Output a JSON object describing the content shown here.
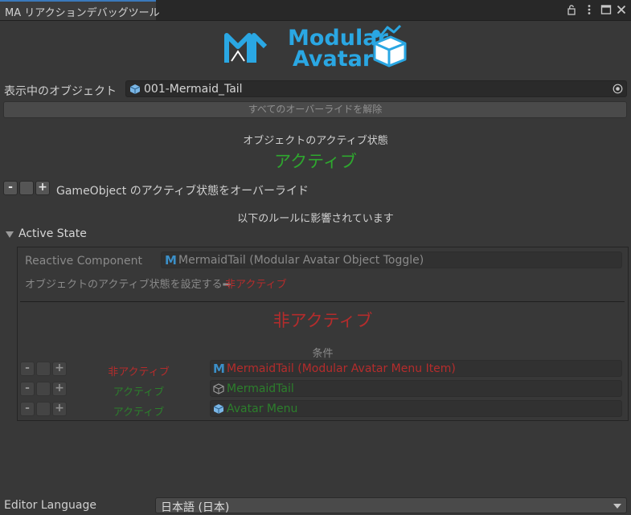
{
  "window": {
    "tab_title": "MA リアクションデバッグツール",
    "icons": [
      "lock-icon",
      "kebab-menu-icon",
      "maximize-icon",
      "close-icon"
    ]
  },
  "logo": {
    "line1": "Modular",
    "line2": "Avatar",
    "color": "#2aa7e3"
  },
  "target": {
    "label": "表示中のオブジェクト",
    "value": "001-Mermaid_Tail"
  },
  "clear_overrides_button": "すべてのオーバーライドを解除",
  "active_state": {
    "heading": "オブジェクトのアクティブ状態",
    "value": "アクティブ",
    "color": "#2ea82e"
  },
  "override": {
    "minus": "-",
    "plus": "+",
    "label": "GameObject のアクティブ状態をオーバーライド"
  },
  "affected_text": "以下のルールに影響されています",
  "foldout": {
    "label": "Active State"
  },
  "rule": {
    "component_label": "Reactive Component",
    "component_value": "MermaidTail (Modular Avatar Object Toggle)",
    "sets_label": "オブジェクトのアクティブ状態を設定する➡",
    "sets_value": "非アクティブ",
    "result": "非アクティブ",
    "conditions_label": "条件",
    "conditions": [
      {
        "state": "非アクティブ",
        "object": "MermaidTail (Modular Avatar Menu Item)",
        "color": "#b52c2c",
        "icon": "modular-avatar-m-icon"
      },
      {
        "state": "アクティブ",
        "object": "MermaidTail",
        "color": "#2c7f2c",
        "icon": "gameobject-cube-icon"
      },
      {
        "state": "アクティブ",
        "object": "Avatar Menu",
        "color": "#2c7f2c",
        "icon": "prefab-cube-icon"
      }
    ]
  },
  "editor_language": {
    "label": "Editor Language",
    "value": "日本語 (日本)"
  }
}
